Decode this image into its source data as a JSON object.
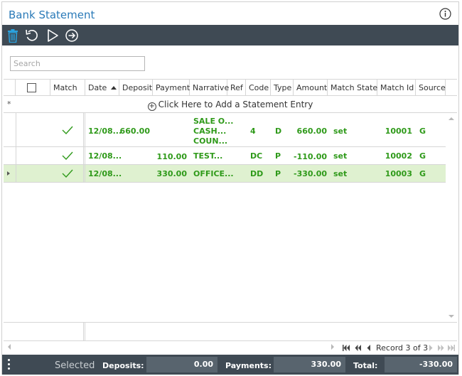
{
  "window": {
    "title": "Bank Statement"
  },
  "toolbar": {
    "icons": [
      "delete-icon",
      "undo-icon",
      "play-icon",
      "arrow-right-circle-icon"
    ],
    "accent_color": "#29a3e0",
    "bg_color": "#3f4a54"
  },
  "search": {
    "placeholder": "Search",
    "value": ""
  },
  "grid": {
    "columns": [
      "Match",
      "Date",
      "Deposit",
      "Payment",
      "Narrative",
      "Ref",
      "Code",
      "Type",
      "Amount",
      "Match State",
      "Match Id",
      "Source"
    ],
    "sort_column": "Date",
    "sort_direction": "ascending",
    "add_row_marker": "*",
    "add_row_text": "Click Here to Add a Statement Entry",
    "rows": [
      {
        "date": "12/08...",
        "deposit": "660.00",
        "payment": "",
        "narrative": [
          "SALE O...",
          "CASH...",
          "COUN..."
        ],
        "ref": "",
        "code": "4",
        "type": "D",
        "amount": "660.00",
        "match_state": "set",
        "match_id": "10001",
        "source": "G",
        "matched": true,
        "selected": false
      },
      {
        "date": "12/08...",
        "deposit": "",
        "payment": "110.00",
        "narrative": [
          "TEST..."
        ],
        "ref": "",
        "code": "DC",
        "type": "P",
        "amount": "-110.00",
        "match_state": "set",
        "match_id": "10002",
        "source": "G",
        "matched": true,
        "selected": false
      },
      {
        "date": "12/08...",
        "deposit": "",
        "payment": "330.00",
        "narrative": [
          "OFFICE..."
        ],
        "ref": "",
        "code": "DD",
        "type": "P",
        "amount": "-330.00",
        "match_state": "set",
        "match_id": "10003",
        "source": "G",
        "matched": true,
        "selected": true
      }
    ],
    "text_color": "#2f9a1a",
    "selected_row_color": "#dff1d0"
  },
  "pager": {
    "text": "Record 3 of 3"
  },
  "footer": {
    "selected_label": "Selected",
    "deposits_label": "Deposits:",
    "deposits_value": "0.00",
    "payments_label": "Payments:",
    "payments_value": "330.00",
    "total_label": "Total:",
    "total_value": "-330.00"
  }
}
